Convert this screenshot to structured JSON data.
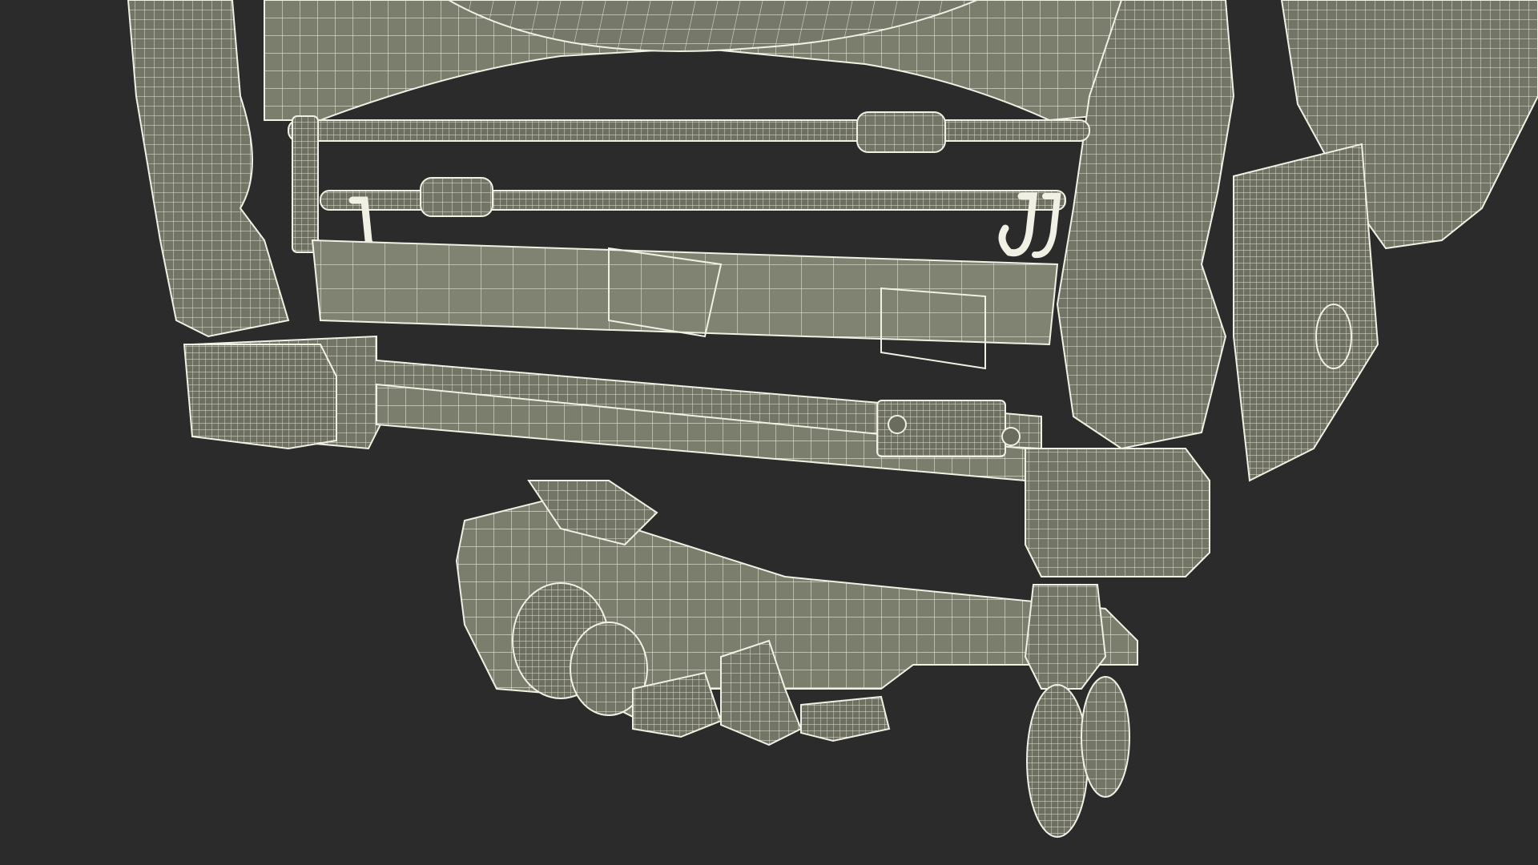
{
  "scene": {
    "background_color": "#2b2b2b",
    "surface_color": "#7b7d6d",
    "surface_dark": "#626455",
    "surface_shadow": "#4f5145",
    "wire_color": "#f1f0e4",
    "subject_icon": "hospital-bed-wireframe-icon",
    "render_style": "wireframe-over-shaded"
  }
}
